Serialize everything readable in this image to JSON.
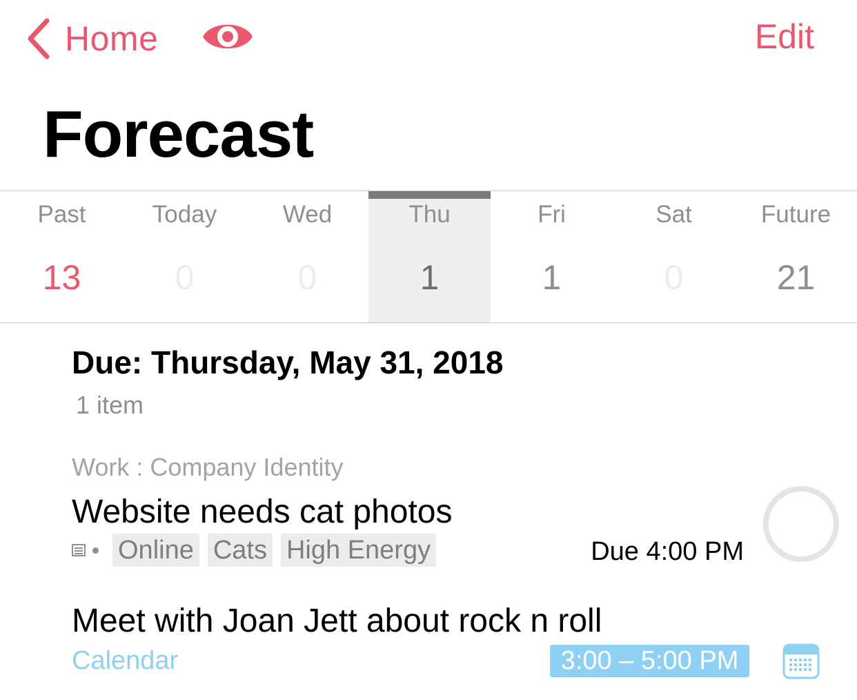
{
  "nav": {
    "back_label": "Home",
    "edit_label": "Edit"
  },
  "page_title": "Forecast",
  "colors": {
    "accent": "#e8586f",
    "calendar": "#8fd0f5",
    "secondary": "#8e8e93"
  },
  "days": [
    {
      "name": "Past",
      "count": "13",
      "count_color": "#e8586f",
      "selected": false
    },
    {
      "name": "Today",
      "count": "0",
      "count_color": "#ececec",
      "selected": false
    },
    {
      "name": "Wed",
      "count": "0",
      "count_color": "#ececec",
      "selected": false
    },
    {
      "name": "Thu",
      "count": "1",
      "count_color": "#6d6d6d",
      "selected": true
    },
    {
      "name": "Fri",
      "count": "1",
      "count_color": "#8e8e93",
      "selected": false
    },
    {
      "name": "Sat",
      "count": "0",
      "count_color": "#ececec",
      "selected": false
    },
    {
      "name": "Future",
      "count": "21",
      "count_color": "#8e8e93",
      "selected": false
    }
  ],
  "section": {
    "heading": "Due: Thursday, May 31, 2018",
    "count": "1 item"
  },
  "task": {
    "project": "Work : Company Identity",
    "title": "Website needs cat photos",
    "tags": [
      "Online",
      "Cats",
      "High Energy"
    ],
    "due": "Due 4:00 PM"
  },
  "event": {
    "title": "Meet with Joan Jett about rock n roll",
    "calendar": "Calendar",
    "time": "3:00 – 5:00 PM"
  }
}
